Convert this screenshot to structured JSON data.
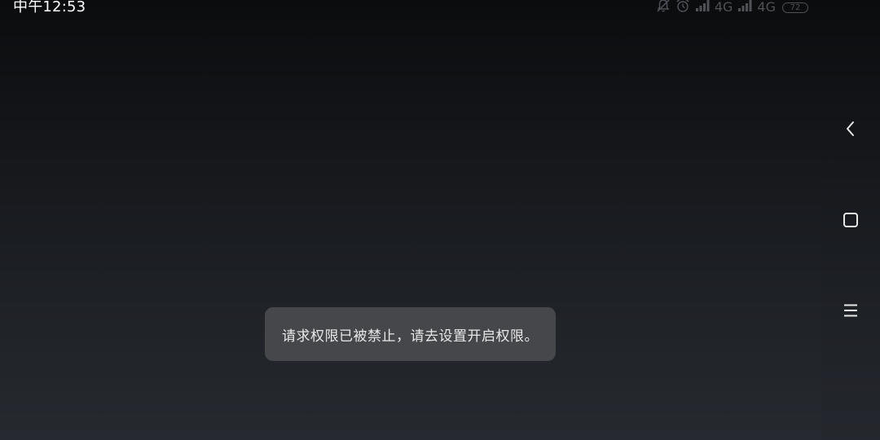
{
  "status_bar": {
    "time": "中午12:53",
    "network_1": "4G",
    "network_2": "4G",
    "battery_level": "72"
  },
  "toast": {
    "message": "请求权限已被禁止，请去设置开启权限。"
  },
  "nav_bar": {
    "buttons": [
      "back-icon",
      "home-icon",
      "menu-icon"
    ]
  },
  "colors": {
    "toast_bg": "#45474b",
    "toast_text": "#e8e8e8",
    "status_icons": "#4e5156"
  }
}
